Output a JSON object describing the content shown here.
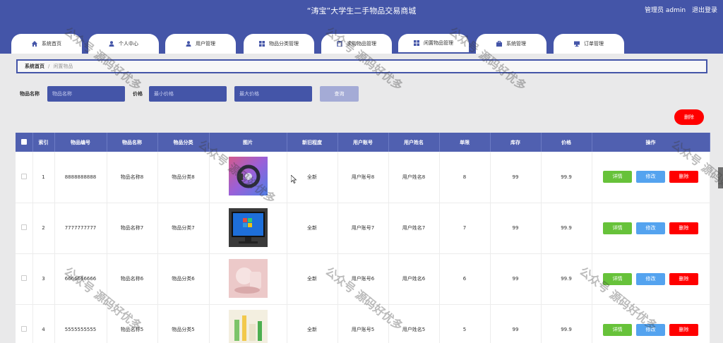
{
  "header": {
    "title": "“涛宝”大学生二手物品交易商城",
    "user_label": "管理员 admin",
    "logout_label": "退出登录"
  },
  "tabs": [
    {
      "label": "系统首页",
      "icon": "home-icon"
    },
    {
      "label": "个人中心",
      "icon": "user-icon"
    },
    {
      "label": "用户管理",
      "icon": "user-icon"
    },
    {
      "label": "物品分类管理",
      "icon": "grid-icon"
    },
    {
      "label": "求购物品管理",
      "icon": "clipboard-icon"
    },
    {
      "label": "闲置物品管理",
      "icon": "grid-icon"
    },
    {
      "label": "系统管理",
      "icon": "briefcase-icon"
    },
    {
      "label": "订单管理",
      "icon": "monitor-icon"
    }
  ],
  "breadcrumb": {
    "home": "系统首页",
    "separator": "/",
    "current": "闲置物品"
  },
  "search": {
    "name_label": "物品名称",
    "name_placeholder": "物品名称",
    "price_label": "价格",
    "min_placeholder": "最小价格",
    "max_placeholder": "最大价格",
    "query_button": "查询"
  },
  "delete_button": "删除",
  "table": {
    "columns": [
      "索引",
      "物品编号",
      "物品名称",
      "物品分类",
      "图片",
      "新旧程度",
      "用户账号",
      "用户姓名",
      "单限",
      "库存",
      "价格",
      "操作"
    ],
    "actions": {
      "detail": "详情",
      "edit": "修改",
      "delete": "删除"
    },
    "rows": [
      {
        "index": "1",
        "code": "8888888888",
        "name": "物品名称8",
        "category": "物品分类8",
        "image": "pink-gradient-gadget",
        "condition": "全新",
        "account": "用户账号8",
        "username": "用户姓名8",
        "limit": "8",
        "stock": "99",
        "price": "99.9"
      },
      {
        "index": "2",
        "code": "7777777777",
        "name": "物品名称7",
        "category": "物品分类7",
        "image": "computer-monitor",
        "condition": "全新",
        "account": "用户账号7",
        "username": "用户姓名7",
        "limit": "7",
        "stock": "99",
        "price": "99.9"
      },
      {
        "index": "3",
        "code": "6666666666",
        "name": "物品名称6",
        "category": "物品分类6",
        "image": "pink-shapes",
        "condition": "全新",
        "account": "用户账号6",
        "username": "用户姓名6",
        "limit": "6",
        "stock": "99",
        "price": "99.9"
      },
      {
        "index": "4",
        "code": "5555555555",
        "name": "物品名称5",
        "category": "物品分类5",
        "image": "cosmetics-bottles",
        "condition": "全新",
        "account": "用户账号5",
        "username": "用户姓名5",
        "limit": "5",
        "stock": "99",
        "price": "99.9"
      }
    ]
  },
  "watermark": "公众号 源码好优多",
  "colors": {
    "primary": "#4455a8",
    "header_row": "#5060b0",
    "detail": "#67c23a",
    "edit": "#54a3ef",
    "delete": "#ff0000"
  }
}
